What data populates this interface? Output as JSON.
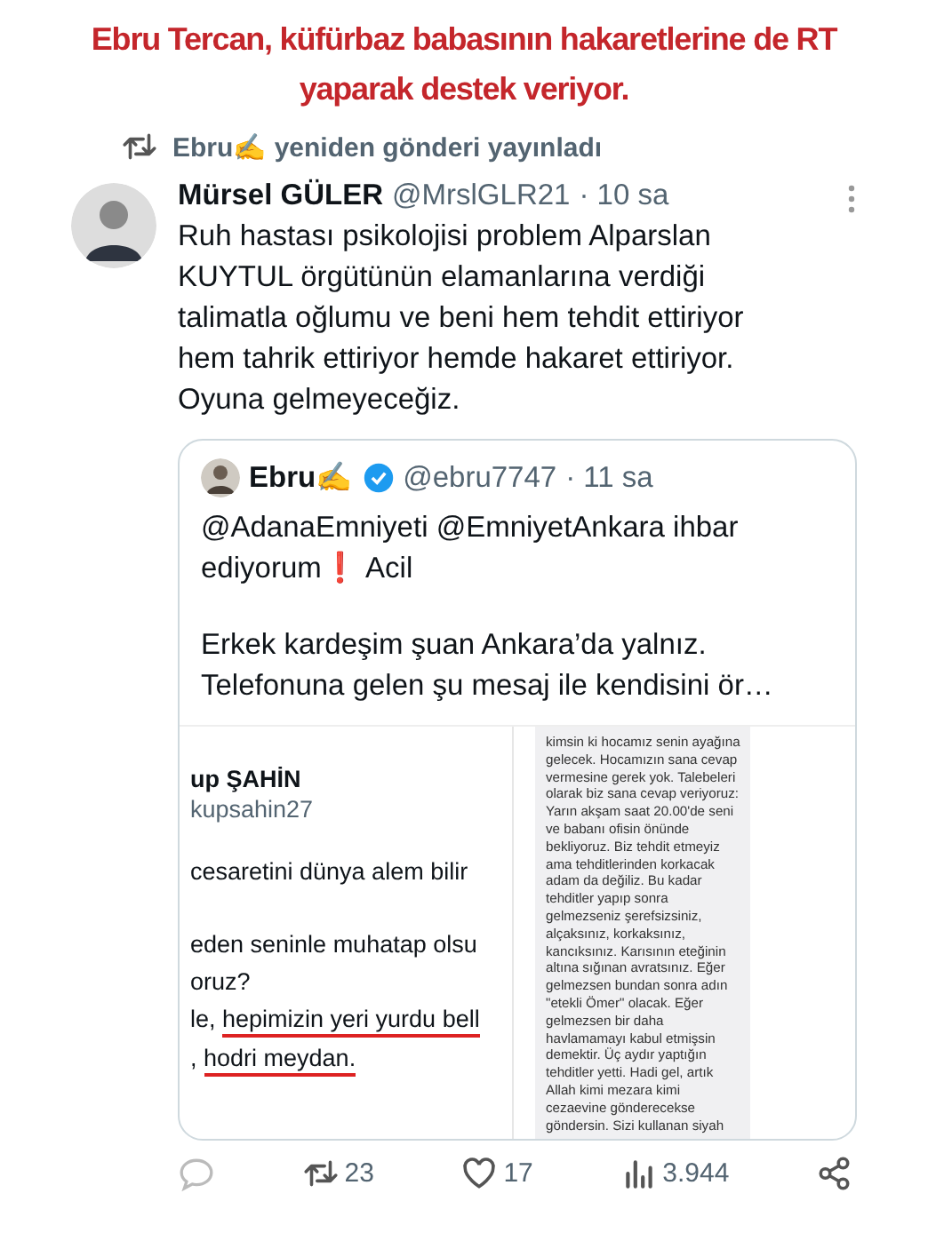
{
  "caption": "Ebru Tercan, küfürbaz babasının hakaretlerine de RT yaparak destek veriyor.",
  "repost_banner": {
    "text": "Ebru✍ yeniden gönderi yayınladı"
  },
  "post": {
    "author": "Mürsel GÜLER",
    "handle": "@MrslGLR21",
    "time": "· 10 sa",
    "text": "Ruh hastası psikolojisi problem Alparslan KUYTUL örgütünün elamanlarına verdiği talimatla oğlumu ve beni hem tehdit ettiriyor hem tahrik ettiriyor hemde hakaret ettiriyor. Oyuna gelmeyeceğiz.",
    "quote": {
      "author": "Ebru✍",
      "verified": true,
      "handle": "@ebru7747",
      "time": "· 11 sa",
      "paragraphs": [
        [
          "@AdanaEmniyeti @EmniyetAnkara ihbar",
          "ediyorum❗ Acil"
        ],
        [
          "Erkek kardeşim şuan Ankara’da yalnız.",
          "Telefonuna gelen şu mesaj ile kendisini ör…"
        ]
      ],
      "media": {
        "left": {
          "name": "up ŞAHİN",
          "handle": "kupsahin27",
          "lines": [
            [
              {
                "text": "cesaretini dünya alem bilir",
                "underlined": false
              }
            ],
            [
              {
                "text": "eden seninle muhatap olsu",
                "underlined": false
              }
            ],
            [
              {
                "text": "oruz?",
                "underlined": false
              }
            ],
            [
              {
                "text": "le, ",
                "underlined": false
              },
              {
                "text": "hepimizin yeri yurdu bell",
                "underlined": true
              }
            ],
            [
              {
                "text": ", ",
                "underlined": false
              },
              {
                "text": "hodri meydan.",
                "underlined": true
              }
            ]
          ]
        },
        "right": {
          "message_lines": [
            "kimsin ki hocamız senin ayağına",
            "gelecek. Hocamızın sana cevap",
            "vermesine gerek yok. Talebeleri",
            "olarak biz sana cevap veriyoruz:",
            "Yarın akşam saat 20.00'de seni",
            "ve babanı ofisin önünde",
            "bekliyoruz. Biz tehdit etmeyiz",
            "ama tehditlerinden korkacak",
            "adam da değiliz. Bu kadar",
            "tehditler yapıp sonra",
            "gelmezseniz şerefsizsiniz,",
            "alçaksınız, korkaksınız,",
            "kancıksınız. Karısının eteğinin",
            "altına sığınan avratsınız. Eğer",
            "gelmezsen bundan sonra adın",
            "\"etekli Ömer\" olacak. Eğer",
            "gelmezsen bir daha",
            "havlamamayı kabul etmişsin",
            "demektir. Üç aydır yaptığın",
            "tehditler yetti. Hadi gel, artık",
            "Allah kimi mezara kimi",
            "cezaevine gönderecekse",
            "göndersin. Sizi kullanan siyah"
          ]
        }
      }
    },
    "actions": [
      {
        "kind": "reply"
      },
      {
        "kind": "repost",
        "count": "23"
      },
      {
        "kind": "like",
        "count": "17"
      },
      {
        "kind": "views",
        "count": "3.944"
      },
      {
        "kind": "share"
      }
    ]
  }
}
